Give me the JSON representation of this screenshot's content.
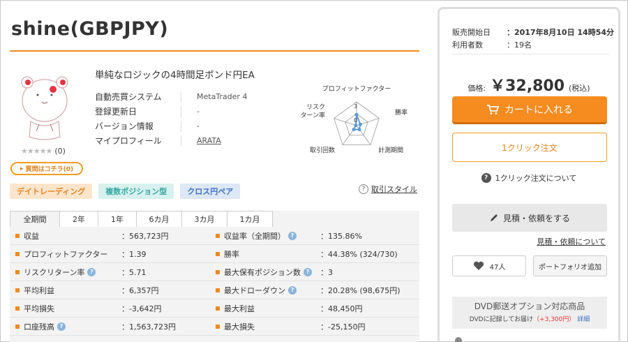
{
  "product": {
    "title": "shine(GBPJPY)",
    "description": "単純なロジックの4時間足ポンド円EA",
    "rating_stars": "★★★★★",
    "rating_count": "(0)",
    "question_button": "質問はコチラ(0)"
  },
  "info": [
    {
      "key": "自動売買システム",
      "value": "MetaTrader 4"
    },
    {
      "key": "登録更新日",
      "value": "-"
    },
    {
      "key": "バージョン情報",
      "value": "-"
    },
    {
      "key": "マイプロフィール",
      "value": "ARATA"
    }
  ],
  "radar": {
    "labels": {
      "top": "プロフィットファクター",
      "right": "勝率",
      "bottom_right": "計測期間",
      "bottom_left": "取引回数",
      "left_line1": "リスク",
      "left_line2": "ターン率"
    },
    "scale_top": "3",
    "scale_zero": "0",
    "values": [
      1.39,
      0.5,
      0.6,
      0.6,
      0.1
    ]
  },
  "tags": [
    "デイトレーディング",
    "複数ポジション型",
    "クロス円ペア"
  ],
  "style_link": "取引スタイル",
  "tabs": [
    "全期間",
    "2年",
    "1年",
    "6カ月",
    "3カ月",
    "1カ月"
  ],
  "stats": [
    [
      {
        "label": "収益",
        "value": "：563,723円",
        "help": false
      },
      {
        "label": "収益率（全期間）",
        "value": "：135.86%",
        "help": true
      }
    ],
    [
      {
        "label": "プロフィットファクター",
        "value": "：1.39",
        "help": false
      },
      {
        "label": "勝率",
        "value": "：44.38% (324/730)",
        "help": false
      }
    ],
    [
      {
        "label": "リスクリターン率",
        "value": "：5.71",
        "help": true
      },
      {
        "label": "最大保有ポジション数",
        "value": "：3",
        "help": true
      }
    ],
    [
      {
        "label": "平均利益",
        "value": "：6,357円",
        "help": false
      },
      {
        "label": "最大ドローダウン",
        "value": "：20.28% (98,675円)",
        "help": true
      }
    ],
    [
      {
        "label": "平均損失",
        "value": "：-3,642円",
        "help": false
      },
      {
        "label": "最大利益",
        "value": "：48,450円",
        "help": false
      }
    ],
    [
      {
        "label": "口座残高",
        "value": "：1,563,723円",
        "help": true
      },
      {
        "label": "最大損失",
        "value": "：-25,150円",
        "help": false
      }
    ]
  ],
  "sidebar": {
    "sale_start_label": "販売開始日",
    "sale_start_value": "：2017年8月10日 14時54分",
    "users_label": "利用者数",
    "users_value": "：19名",
    "price_label": "価格:",
    "price_value": "￥32,800",
    "price_tax": "(税込)",
    "cart_button": "カートに入れる",
    "oneclick_button": "1クリック注文",
    "oneclick_about": "1クリック注文について",
    "quote_button": "見積・依頼をする",
    "quote_link": "見積・依頼について",
    "favorite_count": "47人",
    "portfolio_button": "ポートフォリオ追加",
    "dvd_title": "DVD郵送オプション対応商品",
    "dvd_sub": "DVDに記録してお届け",
    "dvd_price": "（+3,300円）",
    "dvd_detail": "詳細"
  },
  "colors": {
    "accent": "#f68b1f",
    "link_blue": "#3a6fc3",
    "radar_blue": "#5b9bd5"
  }
}
